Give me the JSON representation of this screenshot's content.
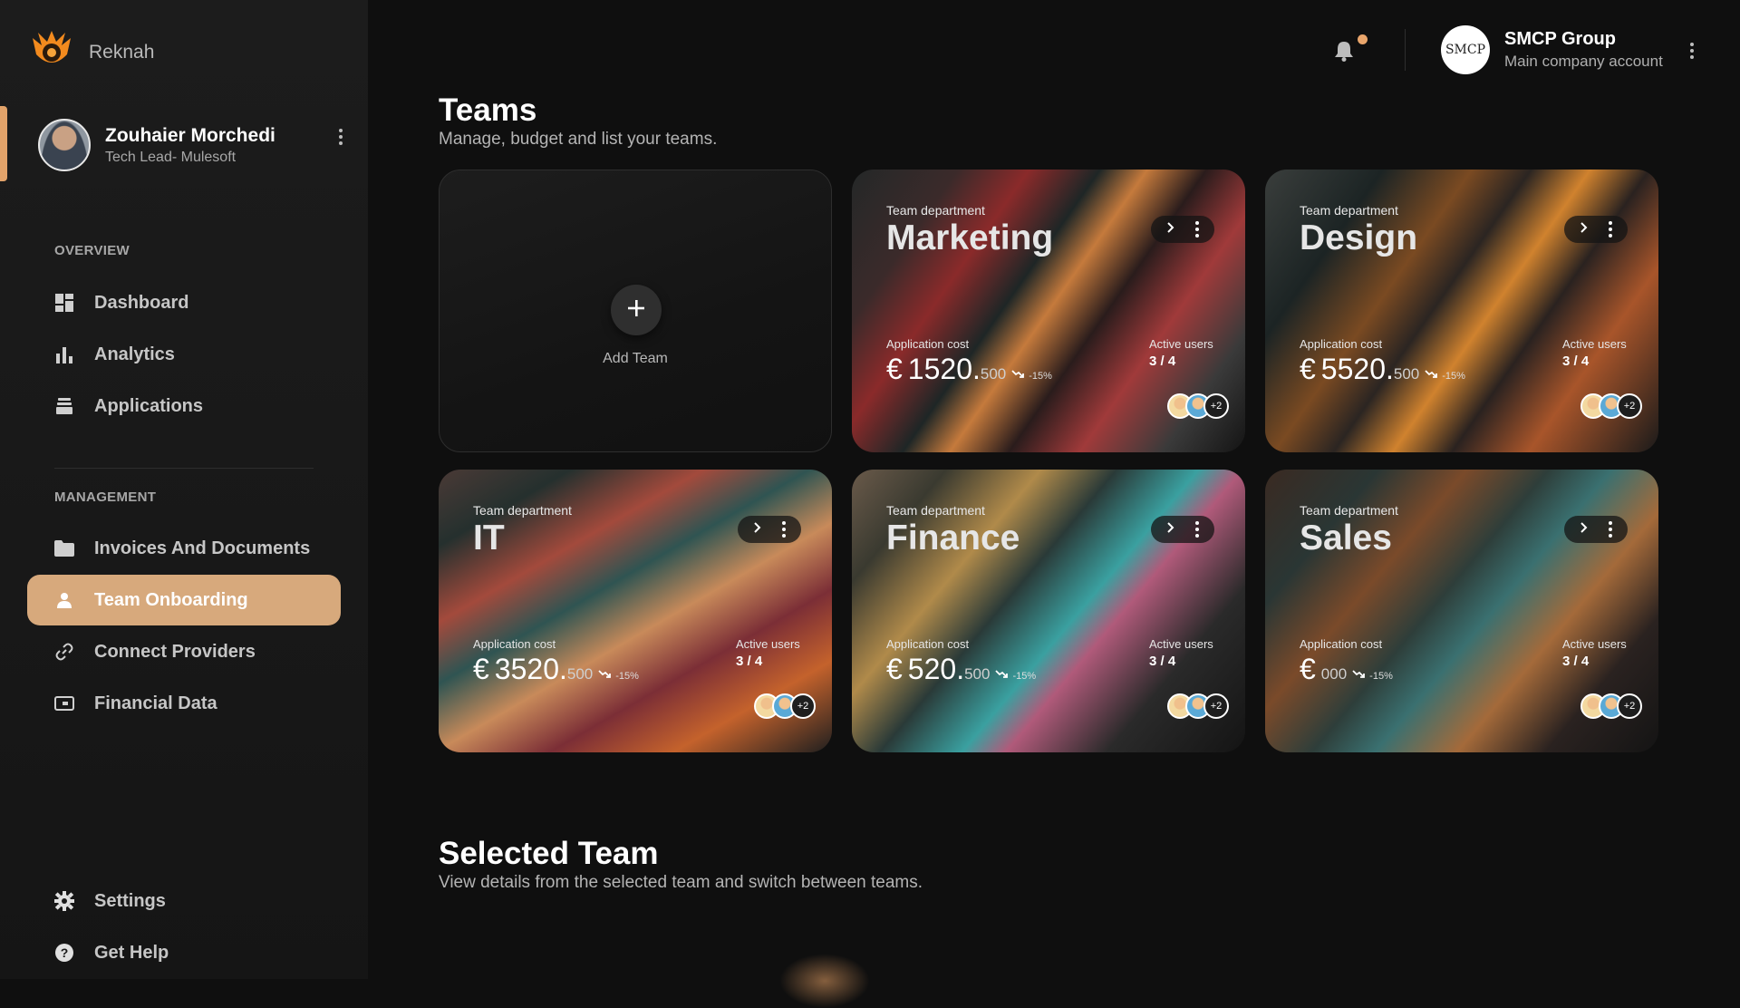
{
  "app": {
    "name": "Reknah"
  },
  "user": {
    "name": "Zouhaier Morchedi",
    "role": "Tech Lead- Mulesoft"
  },
  "sidebar": {
    "overview_label": "OVERVIEW",
    "overview_items": [
      {
        "label": "Dashboard",
        "icon": "dashboard-icon"
      },
      {
        "label": "Analytics",
        "icon": "bar-chart-icon"
      },
      {
        "label": "Applications",
        "icon": "stack-icon"
      }
    ],
    "management_label": "MANAGEMENT",
    "management_items": [
      {
        "label": "Invoices And Documents",
        "icon": "folder-icon"
      },
      {
        "label": "Team Onboarding",
        "icon": "person-icon",
        "active": true
      },
      {
        "label": "Connect Providers",
        "icon": "link-icon"
      },
      {
        "label": "Financial Data",
        "icon": "card-icon"
      }
    ],
    "footer_items": [
      {
        "label": "Settings",
        "icon": "gear-icon"
      },
      {
        "label": "Get Help",
        "icon": "help-icon"
      }
    ]
  },
  "header": {
    "company_logo_text": "SMCP",
    "company_name": "SMCP Group",
    "company_sub": "Main company account"
  },
  "teams": {
    "title": "Teams",
    "subtitle": "Manage, budget and list your teams.",
    "add_label": "Add Team",
    "dept_label": "Team department",
    "cost_label": "Application cost",
    "users_label": "Active users",
    "cards": [
      {
        "name": "Marketing",
        "currency": "€",
        "cost_main": "1520.",
        "cost_dec": "500",
        "trend": "-15%",
        "users": "3 / 4",
        "more": "+2"
      },
      {
        "name": "Design",
        "currency": "€",
        "cost_main": "5520.",
        "cost_dec": "500",
        "trend": "-15%",
        "users": "3 / 4",
        "more": "+2"
      },
      {
        "name": "IT",
        "currency": "€",
        "cost_main": "3520.",
        "cost_dec": "500",
        "trend": "-15%",
        "users": "3 / 4",
        "more": "+2"
      },
      {
        "name": "Finance",
        "currency": "€",
        "cost_main": "520.",
        "cost_dec": "500",
        "trend": "-15%",
        "users": "3 / 4",
        "more": "+2"
      },
      {
        "name": "Sales",
        "currency": "€",
        "cost_main": "",
        "cost_dec": "000",
        "trend": "-15%",
        "users": "3 / 4",
        "more": "+2"
      }
    ]
  },
  "selected_team": {
    "title": "Selected Team",
    "subtitle": "View details from the selected team and switch between teams."
  },
  "colors": {
    "accent": "#d7a97c",
    "background": "#0f0f0f",
    "sidebar": "#1a1a1a"
  }
}
